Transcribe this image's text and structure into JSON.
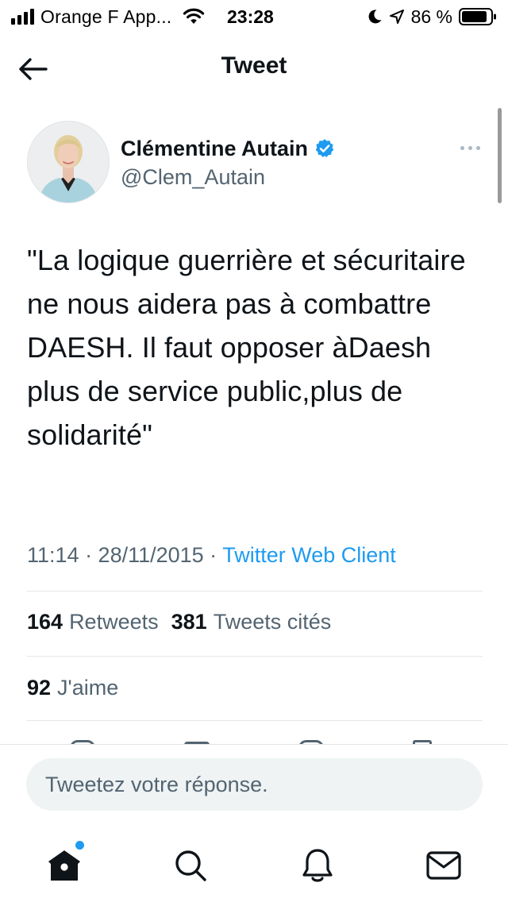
{
  "status_bar": {
    "carrier": "Orange F App...",
    "time": "23:28",
    "battery": "86 %",
    "icons": [
      "signal-icon",
      "wifi-icon",
      "moon-icon",
      "location-icon",
      "battery-icon"
    ]
  },
  "header": {
    "title": "Tweet",
    "back_icon": "arrow-left-icon"
  },
  "tweet": {
    "author_name": "Clémentine Autain",
    "author_handle": "@Clem_Autain",
    "verified": true,
    "text": "\"La logique guerrière et sécuritaire ne nous aidera pas à combattre DAESH. Il faut opposer àDaesh plus de service public,plus de solidarité\"",
    "timestamp": "11:14 · 28/11/2015 · ",
    "client": "Twitter Web Client",
    "retweets_count": "164",
    "retweets_label": "Retweets",
    "quotes_count": "381",
    "quotes_label": "Tweets cités",
    "likes_count": "92",
    "likes_label": "J'aime"
  },
  "reply": {
    "placeholder": "Tweetez votre réponse."
  },
  "tab_bar": {
    "items": [
      {
        "icon": "home-icon",
        "has_notification": true
      },
      {
        "icon": "search-icon"
      },
      {
        "icon": "bell-icon"
      },
      {
        "icon": "mail-icon"
      }
    ]
  },
  "colors": {
    "accent": "#1d9bf0",
    "text_primary": "#0f1419",
    "text_secondary": "#536471",
    "divider": "#e3e7ea",
    "reply_bg": "#eff3f4"
  }
}
